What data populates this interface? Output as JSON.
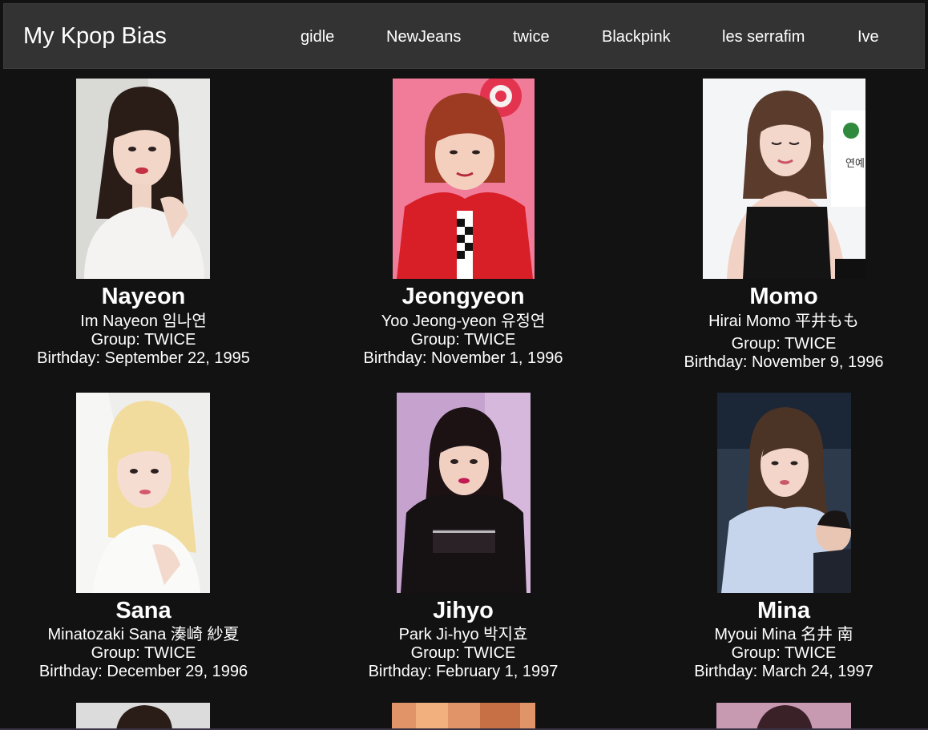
{
  "header": {
    "brand": "My Kpop Bias",
    "nav": [
      {
        "label": "gidle"
      },
      {
        "label": "NewJeans"
      },
      {
        "label": "twice"
      },
      {
        "label": "Blackpink"
      },
      {
        "label": "les serrafim"
      },
      {
        "label": "Ive"
      }
    ]
  },
  "members": [
    {
      "name": "Nayeon",
      "full_name": "Im Nayeon 임나연",
      "group": "Group: TWICE",
      "birthday": "Birthday: September 22, 1995"
    },
    {
      "name": "Jeongyeon",
      "full_name": "Yoo Jeong-yeon 유정연",
      "group": "Group: TWICE",
      "birthday": "Birthday: November 1, 1996"
    },
    {
      "name": "Momo",
      "full_name": "Hirai Momo 平井もも",
      "group": "Group: TWICE",
      "birthday": "Birthday: November 9, 1996"
    },
    {
      "name": "Sana",
      "full_name": "Minatozaki Sana 湊崎 紗夏",
      "group": "Group: TWICE",
      "birthday": "Birthday: December 29, 1996"
    },
    {
      "name": "Jihyo",
      "full_name": "Park Ji-hyo 박지효",
      "group": "Group: TWICE",
      "birthday": "Birthday: February 1, 1997"
    },
    {
      "name": "Mina",
      "full_name": "Myoui Mina 名井 南",
      "group": "Group: TWICE",
      "birthday": "Birthday: March 24, 1997"
    }
  ],
  "colors": {
    "page_bg": "#121212",
    "navbar_bg": "#333333",
    "text": "#ffffff"
  }
}
